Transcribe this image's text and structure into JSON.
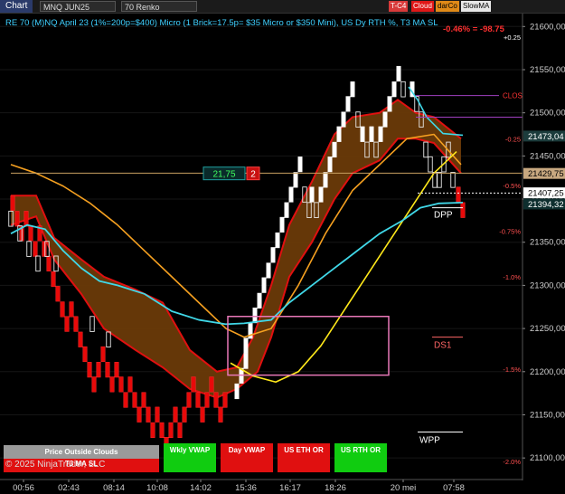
{
  "toolbar": {
    "tab": "Chart",
    "instrument": "MNQ JUN25",
    "bar_type": "70 Renko",
    "buttons": [
      {
        "label": "T-C4",
        "bg": "#d83a3a",
        "fg": "#ffffff"
      },
      {
        "label": "Cloud",
        "bg": "#e01818",
        "fg": "#ffffff"
      },
      {
        "label": "darCo",
        "bg": "#e08a18",
        "fg": "#000000"
      },
      {
        "label": "SlowMA",
        "bg": "#e8e8e8",
        "fg": "#000000"
      }
    ]
  },
  "header": {
    "description": "RE 70 (M)NQ April 23 (1%=200p=$400) Micro (1 Brick=17.5p= $35 Micro or $350 Mini), US Dy RTH %, T3 MA SL",
    "change": "-0.46% = -98.75"
  },
  "bottom_panels": [
    {
      "label": "Price Outside Clouds",
      "sub": "T3 MA SL",
      "bg": "#9a9a9a",
      "bg2": "#e01010"
    },
    {
      "label": "Wkly VWAP",
      "bg": "#10cc10"
    },
    {
      "label": "Day VWAP",
      "bg": "#e01010"
    },
    {
      "label": "US ETH OR",
      "bg": "#e01010"
    },
    {
      "label": "US RTH OR",
      "bg": "#10cc10"
    }
  ],
  "copyright": "© 2025 NinjaTrader, LLC",
  "chart_data": {
    "type": "renko",
    "y_axis": {
      "ticks": [
        21100,
        21150,
        21200,
        21250,
        21300,
        21350,
        21400,
        21450,
        21500,
        21550,
        21600
      ],
      "tick_labels": [
        "21100,00",
        "21150,00",
        "21200,00",
        "21250,00",
        "21300,00",
        "21350,00",
        "21400,00",
        "21450,00",
        "21500,00",
        "21550,00",
        "21600,00"
      ],
      "ylim": [
        21075,
        21615
      ]
    },
    "x_tick_labels": [
      "00:56",
      "02:43",
      "08:14",
      "10:08",
      "14:02",
      "15:36",
      "16:17",
      "18:26",
      "20 mei",
      "07:58"
    ],
    "price_markers": [
      {
        "label": "21473,04",
        "value": 21473.04,
        "bg": "#1c3c3c",
        "fg": "#ffffff"
      },
      {
        "label": "21429,75",
        "value": 21429.75,
        "bg": "#c8a880",
        "fg": "#000000"
      },
      {
        "label": "21407,25",
        "value": 21407.25,
        "bg": "#ffffff",
        "fg": "#000000"
      },
      {
        "label": "21394,32",
        "value": 21394.32,
        "bg": "#0e2e2e",
        "fg": "#ffffff"
      }
    ],
    "percent_labels": [
      {
        "label": "+0.25",
        "value": 21588
      },
      {
        "label": "-0.25",
        "value": 21470
      },
      {
        "label": "-0.5%",
        "value": 21416
      },
      {
        "label": "-0.75%",
        "value": 21363
      },
      {
        "label": "-1.0%",
        "value": 21310
      },
      {
        "label": "-1.5%",
        "value": 21203
      },
      {
        "label": "-2.0%",
        "value": 21096
      }
    ],
    "level_labels": [
      {
        "label": "CLOS",
        "value": 21520,
        "color": "#ff3333"
      },
      {
        "label": "DPP",
        "value": 21389,
        "color": "#ffffff"
      },
      {
        "label": "DS1",
        "value": 21238,
        "color": "#ff6666"
      },
      {
        "label": "WPP",
        "value": 21128,
        "color": "#ffffff"
      }
    ],
    "order_box": {
      "value": "21,75",
      "qty": "2",
      "price": 21429.75
    },
    "renko_up": [
      [
        262,
        21186
      ],
      [
        267,
        21204
      ],
      [
        272,
        21221
      ],
      [
        272,
        21239
      ],
      [
        277,
        21256
      ],
      [
        282,
        21274
      ],
      [
        287,
        21291
      ],
      [
        292,
        21309
      ],
      [
        297,
        21326
      ],
      [
        302,
        21344
      ],
      [
        307,
        21361
      ],
      [
        312,
        21379
      ],
      [
        317,
        21396
      ],
      [
        322,
        21414
      ],
      [
        327,
        21431
      ],
      [
        332,
        21449
      ],
      [
        345,
        21414
      ],
      [
        355,
        21414
      ],
      [
        360,
        21431
      ],
      [
        365,
        21449
      ],
      [
        370,
        21466
      ],
      [
        375,
        21484
      ],
      [
        380,
        21501
      ],
      [
        385,
        21519
      ],
      [
        390,
        21536
      ],
      [
        401,
        21484
      ],
      [
        411,
        21484
      ],
      [
        421,
        21484
      ],
      [
        426,
        21501
      ],
      [
        431,
        21519
      ],
      [
        436,
        21536
      ],
      [
        441,
        21554
      ],
      [
        456,
        21536
      ]
    ],
    "renko_hollow": [
      [
        337,
        21414
      ],
      [
        342,
        21396
      ],
      [
        350,
        21396
      ],
      [
        396,
        21501
      ],
      [
        406,
        21466
      ],
      [
        416,
        21466
      ],
      [
        446,
        21536
      ],
      [
        461,
        21519
      ],
      [
        466,
        21501
      ],
      [
        471,
        21466
      ],
      [
        476,
        21449
      ],
      [
        481,
        21431
      ],
      [
        486,
        21431
      ],
      [
        491,
        21449
      ],
      [
        496,
        21466
      ],
      [
        501,
        21431
      ],
      [
        12,
        21386
      ],
      [
        22,
        21369
      ],
      [
        32,
        21351
      ],
      [
        42,
        21334
      ],
      [
        52,
        21351
      ],
      [
        62,
        21334
      ],
      [
        102,
        21264
      ],
      [
        120,
        21246
      ]
    ],
    "renko_down": [
      [
        14,
        21404
      ],
      [
        19,
        21386
      ],
      [
        24,
        21369
      ],
      [
        29,
        21386
      ],
      [
        34,
        21369
      ],
      [
        39,
        21351
      ],
      [
        44,
        21369
      ],
      [
        49,
        21351
      ],
      [
        54,
        21334
      ],
      [
        59,
        21316
      ],
      [
        64,
        21299
      ],
      [
        69,
        21281
      ],
      [
        74,
        21264
      ],
      [
        79,
        21281
      ],
      [
        84,
        21264
      ],
      [
        89,
        21246
      ],
      [
        94,
        21229
      ],
      [
        99,
        21211
      ],
      [
        104,
        21194
      ],
      [
        109,
        21211
      ],
      [
        114,
        21229
      ],
      [
        119,
        21211
      ],
      [
        124,
        21194
      ],
      [
        129,
        21211
      ],
      [
        134,
        21194
      ],
      [
        139,
        21176
      ],
      [
        144,
        21194
      ],
      [
        149,
        21176
      ],
      [
        154,
        21159
      ],
      [
        159,
        21176
      ],
      [
        164,
        21159
      ],
      [
        169,
        21141
      ],
      [
        174,
        21159
      ],
      [
        179,
        21141
      ],
      [
        184,
        21124
      ],
      [
        189,
        21141
      ],
      [
        194,
        21159
      ],
      [
        199,
        21141
      ],
      [
        204,
        21159
      ],
      [
        209,
        21176
      ],
      [
        214,
        21194
      ],
      [
        219,
        21176
      ],
      [
        224,
        21159
      ],
      [
        229,
        21176
      ],
      [
        234,
        21194
      ],
      [
        239,
        21176
      ],
      [
        244,
        21159
      ],
      [
        249,
        21176
      ],
      [
        507,
        21414
      ],
      [
        512,
        21396
      ]
    ],
    "cloud_upper": [
      [
        12,
        21404
      ],
      [
        40,
        21404
      ],
      [
        60,
        21355
      ],
      [
        90,
        21330
      ],
      [
        115,
        21310
      ],
      [
        150,
        21295
      ],
      [
        180,
        21280
      ],
      [
        210,
        21225
      ],
      [
        240,
        21200
      ],
      [
        262,
        21205
      ],
      [
        280,
        21240
      ],
      [
        300,
        21300
      ],
      [
        320,
        21370
      ],
      [
        345,
        21420
      ],
      [
        370,
        21475
      ],
      [
        390,
        21495
      ],
      [
        420,
        21500
      ],
      [
        440,
        21515
      ],
      [
        460,
        21500
      ],
      [
        480,
        21495
      ],
      [
        510,
        21470
      ]
    ],
    "cloud_lower": [
      [
        12,
        21370
      ],
      [
        40,
        21380
      ],
      [
        60,
        21330
      ],
      [
        90,
        21290
      ],
      [
        115,
        21250
      ],
      [
        150,
        21225
      ],
      [
        180,
        21205
      ],
      [
        210,
        21180
      ],
      [
        240,
        21170
      ],
      [
        262,
        21180
      ],
      [
        285,
        21200
      ],
      [
        300,
        21240
      ],
      [
        320,
        21310
      ],
      [
        345,
        21350
      ],
      [
        370,
        21400
      ],
      [
        390,
        21430
      ],
      [
        420,
        21445
      ],
      [
        440,
        21470
      ],
      [
        460,
        21470
      ],
      [
        480,
        21465
      ],
      [
        510,
        21430
      ]
    ],
    "ema_orange": [
      [
        12,
        21440
      ],
      [
        40,
        21430
      ],
      [
        70,
        21415
      ],
      [
        100,
        21395
      ],
      [
        130,
        21370
      ],
      [
        160,
        21340
      ],
      [
        190,
        21310
      ],
      [
        220,
        21280
      ],
      [
        250,
        21250
      ],
      [
        270,
        21240
      ],
      [
        300,
        21250
      ],
      [
        330,
        21300
      ],
      [
        360,
        21360
      ],
      [
        390,
        21410
      ],
      [
        420,
        21440
      ],
      [
        450,
        21470
      ],
      [
        480,
        21475
      ],
      [
        510,
        21440
      ]
    ],
    "t3_yellow": [
      [
        255,
        21210
      ],
      [
        280,
        21195
      ],
      [
        305,
        21188
      ],
      [
        330,
        21200
      ],
      [
        355,
        21230
      ],
      [
        380,
        21270
      ],
      [
        405,
        21310
      ],
      [
        430,
        21350
      ],
      [
        455,
        21390
      ],
      [
        480,
        21430
      ],
      [
        505,
        21455
      ]
    ],
    "vwap_cyan": [
      [
        12,
        21360
      ],
      [
        30,
        21370
      ],
      [
        50,
        21365
      ],
      [
        70,
        21340
      ],
      [
        90,
        21320
      ],
      [
        110,
        21305
      ],
      [
        130,
        21300
      ],
      [
        160,
        21290
      ],
      [
        190,
        21270
      ],
      [
        220,
        21260
      ],
      [
        250,
        21255
      ],
      [
        270,
        21256
      ],
      [
        300,
        21260
      ],
      [
        320,
        21280
      ],
      [
        345,
        21300
      ],
      [
        370,
        21320
      ],
      [
        395,
        21340
      ],
      [
        420,
        21360
      ],
      [
        445,
        21375
      ],
      [
        465,
        21390
      ],
      [
        485,
        21395
      ],
      [
        512,
        21396
      ]
    ],
    "cyan_short": [
      [
        452,
        21530
      ],
      [
        462,
        21515
      ],
      [
        472,
        21495
      ],
      [
        490,
        21476
      ],
      [
        512,
        21474
      ]
    ],
    "h_lines": [
      {
        "value": 21520,
        "color": "#a040c0",
        "x1": 460,
        "x2": 552
      },
      {
        "value": 21495,
        "color": "#a040c0",
        "x1": 460,
        "x2": 578
      },
      {
        "value": 21430,
        "color": "#c8a060",
        "x1": 12,
        "x2": 578
      },
      {
        "value": 21407,
        "color": "#ffffff",
        "x1": 462,
        "x2": 578,
        "dashed": true
      },
      {
        "value": 21390,
        "color": "#ffffff",
        "x1": 478,
        "x2": 512
      },
      {
        "value": 21240,
        "color": "#ff6666",
        "x1": 478,
        "x2": 512
      },
      {
        "value": 21130,
        "color": "#ffffff",
        "x1": 462,
        "x2": 512
      }
    ],
    "pink_box": {
      "x1": 252,
      "x2": 430,
      "top": 21264,
      "bottom": 21196
    }
  }
}
